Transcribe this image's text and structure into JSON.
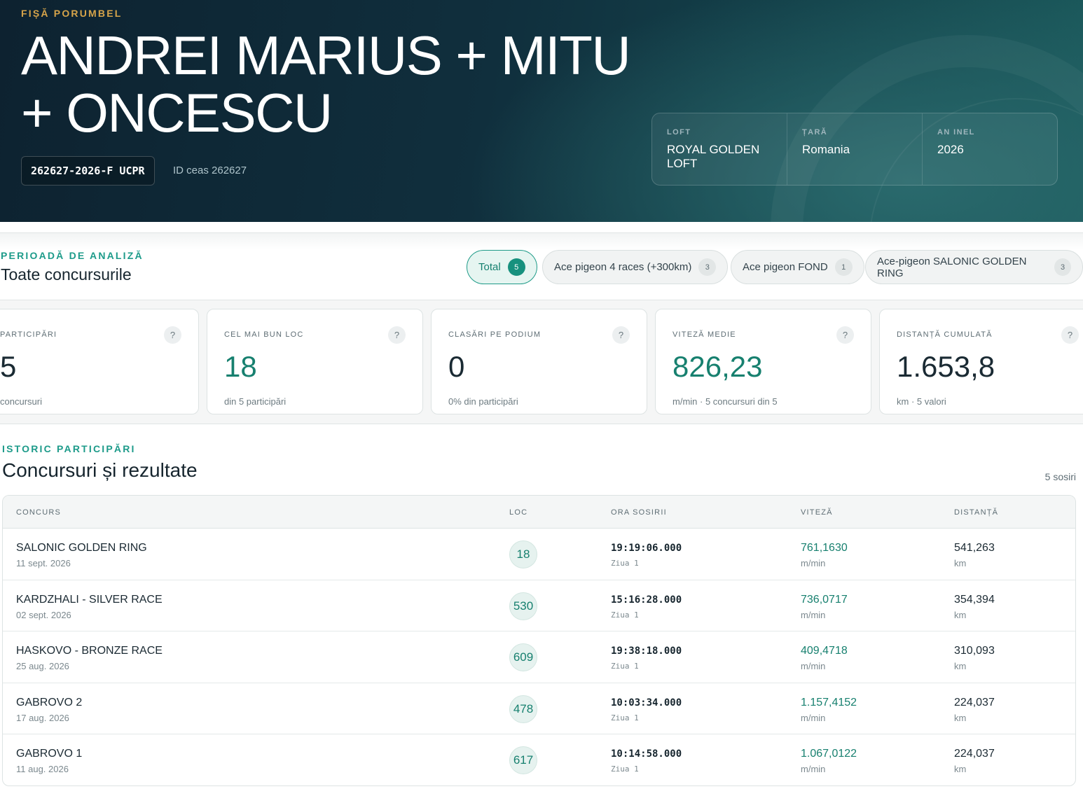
{
  "header": {
    "eyebrow": "FIȘĂ PORUMBEL",
    "pigeon_name": "ANDREI MARIUS + MITU + ONCESCU",
    "ring_badge": "262627-2026-F UCPR",
    "clock_id": "ID ceas 262627",
    "info": [
      {
        "label": "LOFT",
        "value": "ROYAL GOLDEN LOFT"
      },
      {
        "label": "ȚARĂ",
        "value": "Romania"
      },
      {
        "label": "AN INEL",
        "value": "2026"
      }
    ]
  },
  "period": {
    "eyebrow": "PERIOADĂ DE ANALIZĂ",
    "title": "Toate concursurile",
    "chips": [
      {
        "label": "Total",
        "count": "5",
        "active": true
      },
      {
        "label": "Ace pigeon 4 races (+300km)",
        "count": "3",
        "active": false
      },
      {
        "label": "Ace pigeon FOND",
        "count": "1",
        "active": false
      },
      {
        "label": "Ace-pigeon SALONIC GOLDEN RING",
        "count": "3",
        "active": false
      }
    ]
  },
  "stats": [
    {
      "label": "PARTICIPĂRI",
      "help": "?",
      "value": "5",
      "sub": "concursuri",
      "accent": false
    },
    {
      "label": "CEL MAI BUN LOC",
      "help": "?",
      "value": "18",
      "sub": "din 5 participări",
      "accent": true
    },
    {
      "label": "CLASĂRI PE PODIUM",
      "help": "?",
      "value": "0",
      "sub": "0% din participări",
      "accent": false
    },
    {
      "label": "VITEZĂ MEDIE",
      "help": "?",
      "value": "826,23",
      "sub": "m/min · 5 concursuri din 5",
      "accent": true
    },
    {
      "label": "DISTANȚĂ CUMULATĂ",
      "help": "?",
      "value": "1.653,8",
      "sub": "km · 5 valori",
      "accent": false
    }
  ],
  "history": {
    "eyebrow": "ISTORIC PARTICIPĂRI",
    "title": "Concursuri și rezultate",
    "arrivals_count": "5 sosiri",
    "columns": [
      "CONCURS",
      "LOC",
      "ORA SOSIRII",
      "VITEZĂ",
      "DISTANȚĂ"
    ],
    "rows": [
      {
        "race": "SALONIC GOLDEN RING",
        "date": "11 sept. 2026",
        "place": "18",
        "time": "19:19:06.000",
        "day": "Ziua 1",
        "speed": "761,1630",
        "speed_unit": "m/min",
        "distance": "541,263",
        "distance_unit": "km"
      },
      {
        "race": "KARDZHALI - SILVER RACE",
        "date": "02 sept. 2026",
        "place": "530",
        "time": "15:16:28.000",
        "day": "Ziua 1",
        "speed": "736,0717",
        "speed_unit": "m/min",
        "distance": "354,394",
        "distance_unit": "km"
      },
      {
        "race": "HASKOVO - BRONZE RACE",
        "date": "25 aug. 2026",
        "place": "609",
        "time": "19:38:18.000",
        "day": "Ziua 1",
        "speed": "409,4718",
        "speed_unit": "m/min",
        "distance": "310,093",
        "distance_unit": "km"
      },
      {
        "race": "GABROVO 2",
        "date": "17 aug. 2026",
        "place": "478",
        "time": "10:03:34.000",
        "day": "Ziua 1",
        "speed": "1.157,4152",
        "speed_unit": "m/min",
        "distance": "224,037",
        "distance_unit": "km"
      },
      {
        "race": "GABROVO 1",
        "date": "11 aug. 2026",
        "place": "617",
        "time": "10:14:58.000",
        "day": "Ziua 1",
        "speed": "1.067,0122",
        "speed_unit": "m/min",
        "distance": "224,037",
        "distance_unit": "km"
      }
    ]
  },
  "colors": {
    "accent_teal": "#17806f",
    "eyebrow_gold": "#d6a44a",
    "hero_dark": "#0d2230"
  }
}
